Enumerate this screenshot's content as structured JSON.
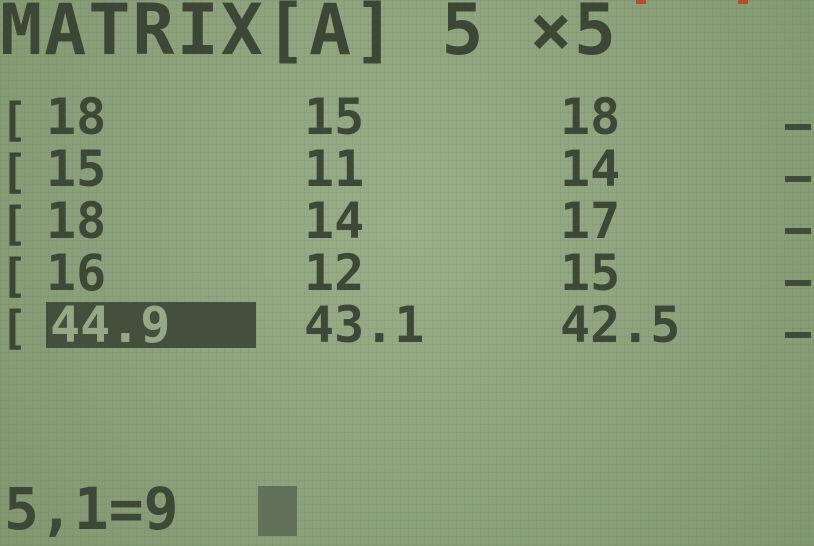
{
  "screen": {
    "title": "MATRIX[A] 5 ×5",
    "bracket": "[",
    "rows": [
      {
        "values": [
          "18",
          "15",
          "18"
        ]
      },
      {
        "values": [
          "15",
          "11",
          "14"
        ]
      },
      {
        "values": [
          "18",
          "14",
          "17"
        ]
      },
      {
        "values": [
          "16",
          "12",
          "15"
        ]
      },
      {
        "values": [
          "44.9",
          "43.1",
          "42.5"
        ]
      }
    ],
    "entry": "5,1=9"
  },
  "colors": {
    "lcd_background": "#8ea47f",
    "lcd_text": "#3d4937",
    "selected_cell": "#42503d",
    "corner_mark": "#b54d2a"
  }
}
